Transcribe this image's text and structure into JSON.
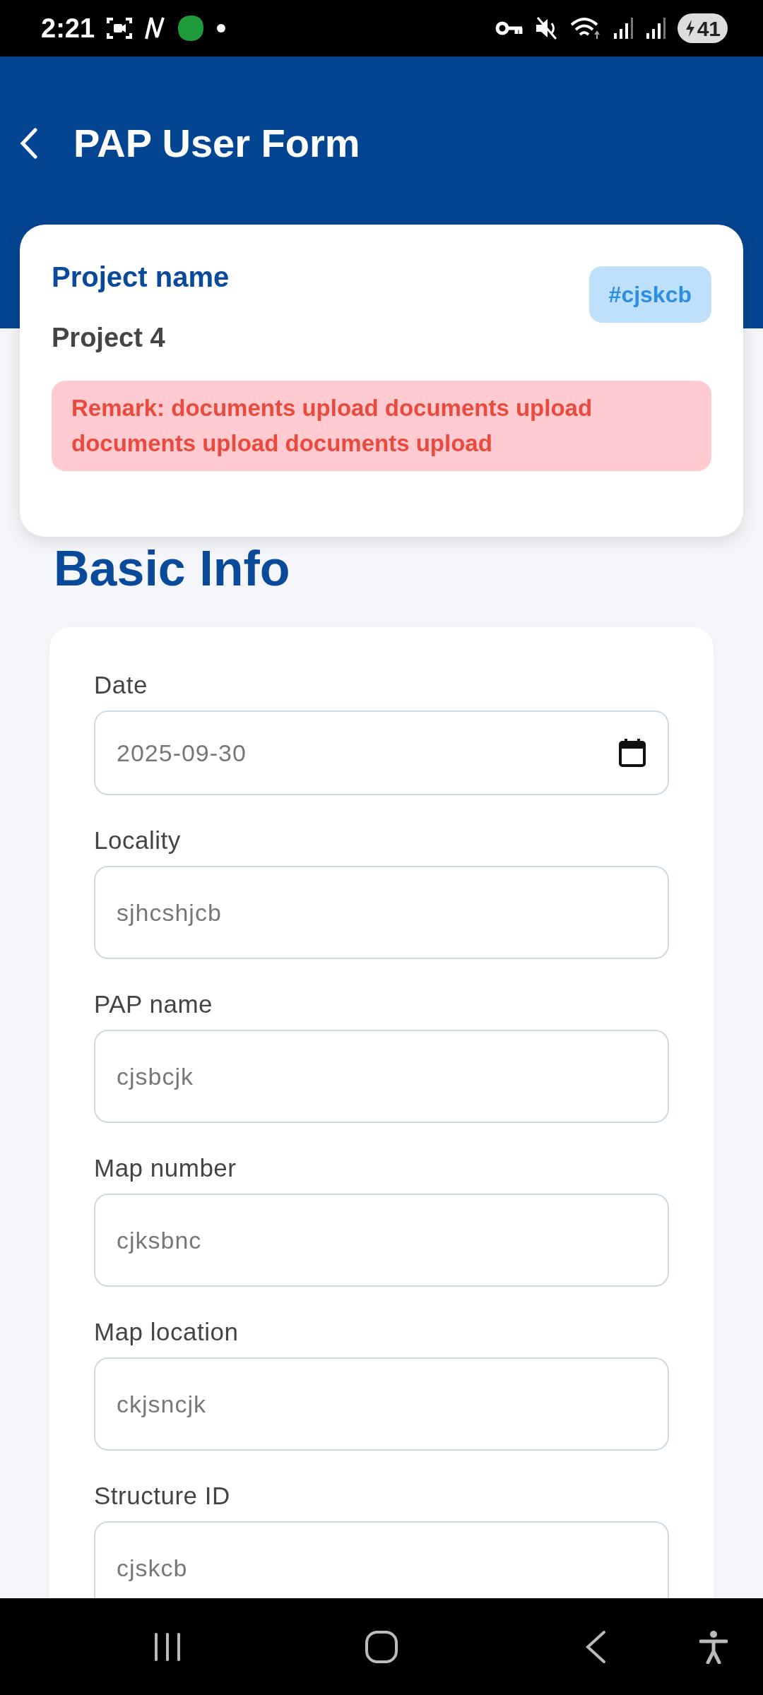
{
  "status_bar": {
    "time": "2:21",
    "battery": "41"
  },
  "header": {
    "title": "PAP User Form"
  },
  "project_card": {
    "label": "Project name",
    "name": "Project 4",
    "tag": "#cjskcb",
    "remark": "Remark: documents upload documents upload documents upload documents upload"
  },
  "section": {
    "title": "Basic Info"
  },
  "fields": [
    {
      "label": "Date",
      "kind": "date",
      "value": "2025-09-30"
    },
    {
      "label": "Locality",
      "kind": "text",
      "value": "sjhcshjcb"
    },
    {
      "label": "PAP name",
      "kind": "text",
      "value": "cjsbcjk"
    },
    {
      "label": "Map number",
      "kind": "text",
      "value": "cjksbnc"
    },
    {
      "label": "Map location",
      "kind": "text",
      "value": "ckjsncjk"
    },
    {
      "label": "Structure ID",
      "kind": "text",
      "value": "cjskcb"
    }
  ]
}
